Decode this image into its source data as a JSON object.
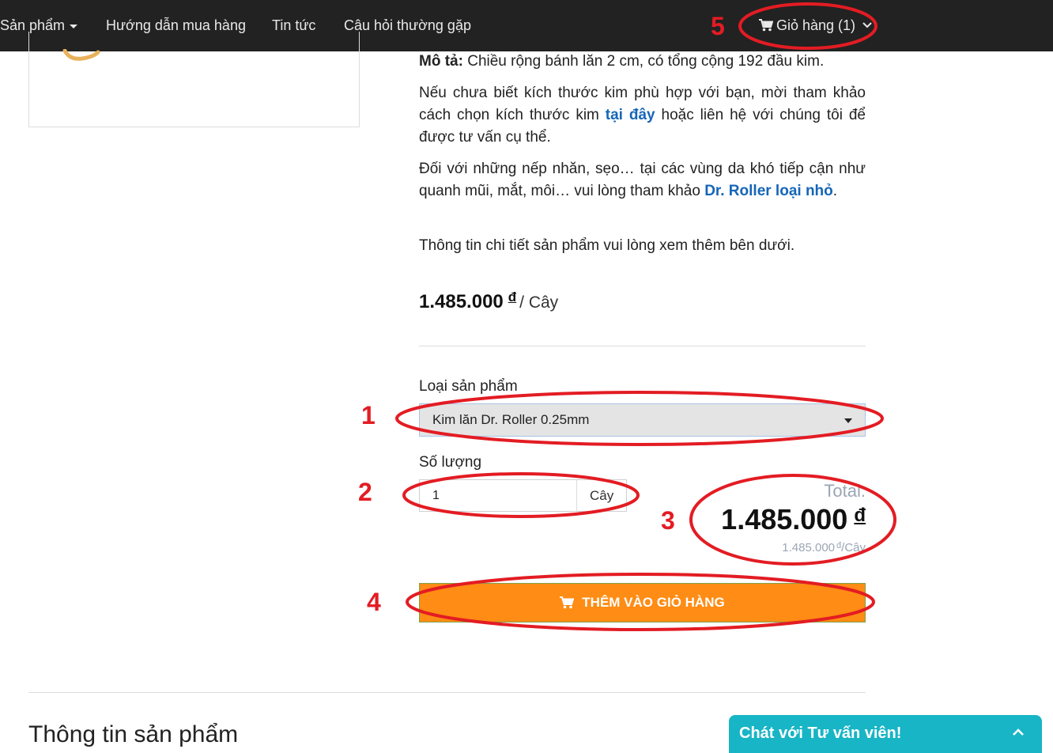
{
  "nav": {
    "items": [
      {
        "label": "Sản phẩm",
        "has_caret": true
      },
      {
        "label": "Hướng dẫn mua hàng"
      },
      {
        "label": "Tin tức"
      },
      {
        "label": "Câu hỏi thường gặp"
      }
    ],
    "cart_label": "Giỏ hàng (1)",
    "cart_icon": "shopping-cart-icon"
  },
  "description": {
    "p1_label": "Mô tả:",
    "p1_text": " Chiều rộng bánh lăn 2 cm, có tổng cộng 192 đầu kim.",
    "p2_before": "Nếu chưa biết kích thước kim phù hợp với bạn, mời tham khảo cách chọn kích thước kim ",
    "p2_link": "tại đây",
    "p2_after": " hoặc liên hệ với chúng tôi để được tư vấn cụ thể.",
    "p3_before": "Đối với những nếp nhăn, sẹo… tại các vùng da khó tiếp cận như quanh mũi, mắt, môi… vui lòng tham khảo ",
    "p3_link": "Dr. Roller loại nhỏ",
    "p3_after": ".",
    "p4": "Thông tin chi tiết sản phẩm vui lòng xem thêm bên dưới."
  },
  "price": {
    "amount": "1.485.000",
    "currency": "đ",
    "unit": "/ Cây"
  },
  "form": {
    "type_label": "Loại sản phẩm",
    "type_value": "Kim lăn Dr. Roller 0.25mm",
    "qty_label": "Số lượng",
    "qty_value": "1",
    "qty_unit": "Cây"
  },
  "total": {
    "label": "Total:",
    "amount": "1.485.000",
    "currency": "đ",
    "unit_price": "1.485.000",
    "unit_currency": "đ",
    "unit_suffix": "/Cây"
  },
  "add_button": {
    "label": "THÊM VÀO GIỎ HÀNG",
    "icon": "shopping-cart-icon"
  },
  "section_title": "Thông tin sản phẩm",
  "chat": {
    "label": "Chát với Tư vấn viên!",
    "icon": "chevron-up-icon"
  },
  "annotations": [
    "1",
    "2",
    "3",
    "4",
    "5"
  ],
  "colors": {
    "navbar": "#222222",
    "link": "#1566b7",
    "button": "#ff8c14",
    "chat": "#17b5c5",
    "annotation": "#e31c23"
  }
}
